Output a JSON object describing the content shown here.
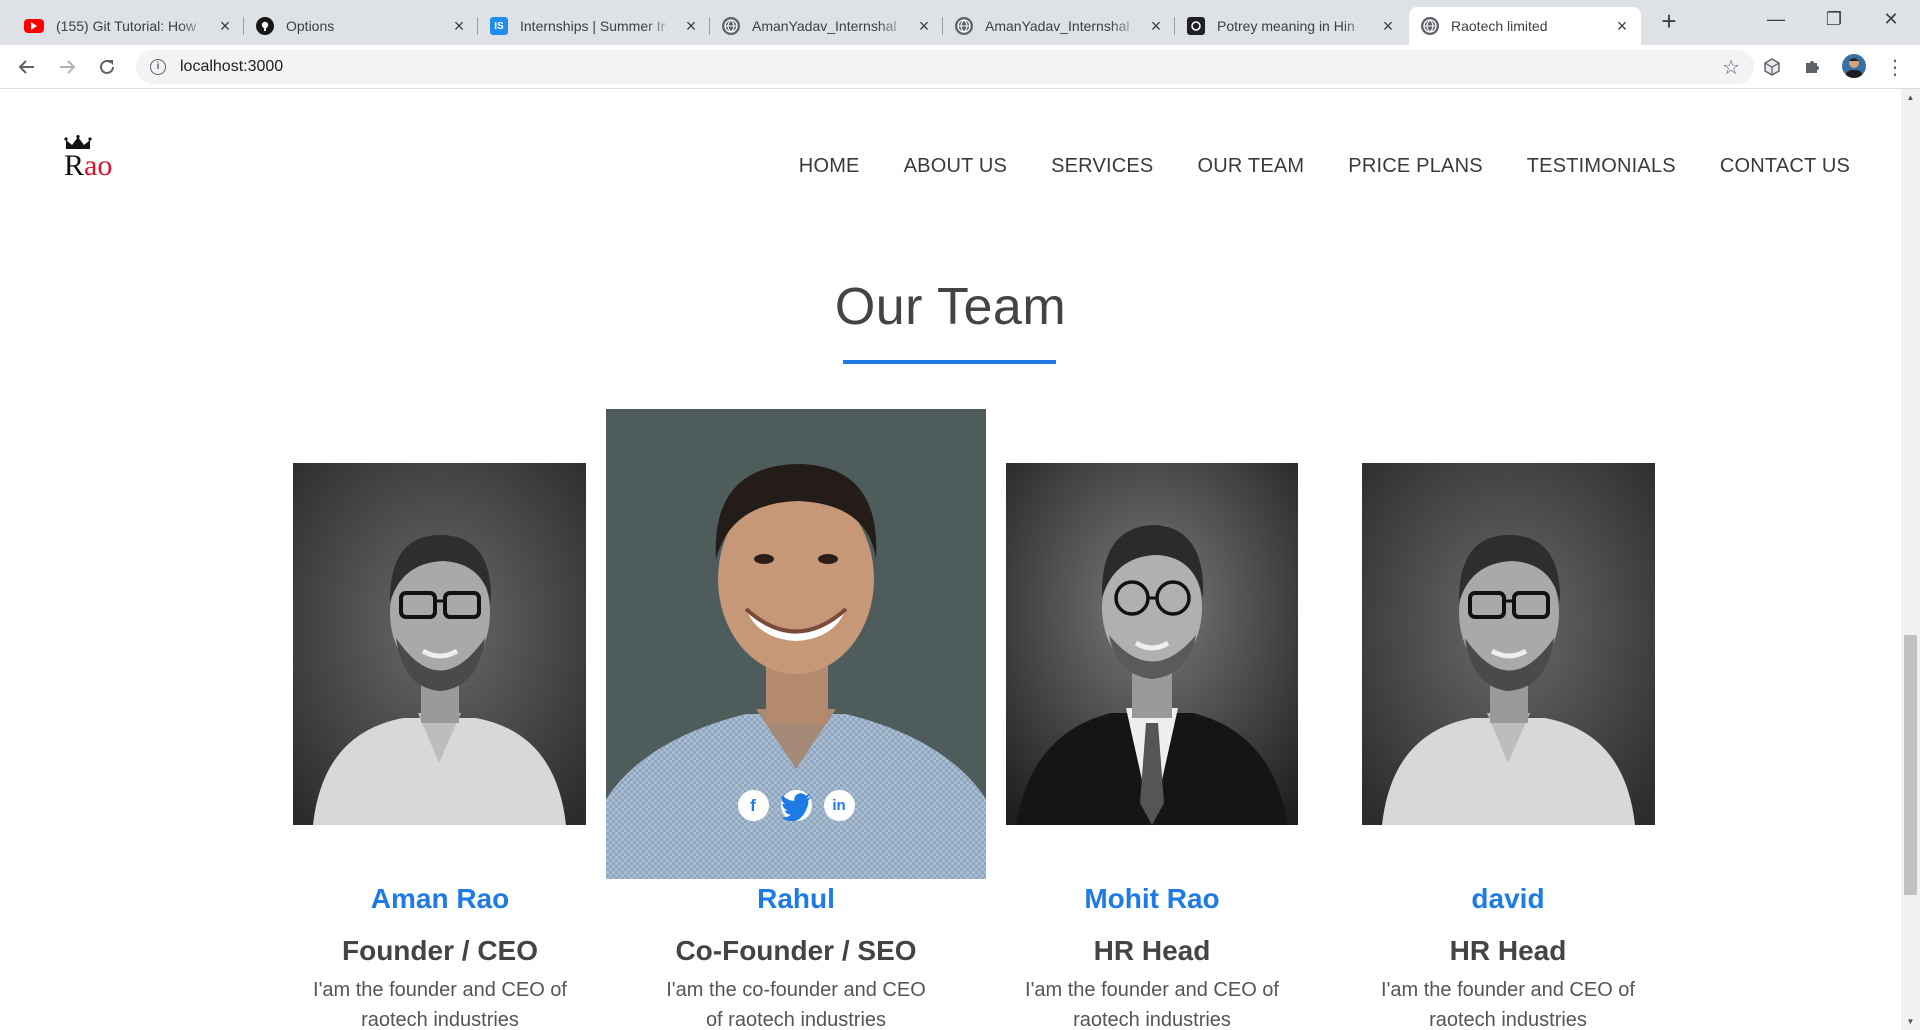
{
  "browser": {
    "tabs": [
      {
        "title": "(155) Git Tutorial: How",
        "icon": "youtube-icon",
        "color": "#ff0000"
      },
      {
        "title": "Options",
        "icon": "github-icon",
        "color": "#181717"
      },
      {
        "title": "Internships | Summer Ir",
        "icon": "internshala-icon",
        "color": "#1f8ded"
      },
      {
        "title": "AmanYadav_Internshal",
        "icon": "globe-icon",
        "color": "#5f6368"
      },
      {
        "title": "AmanYadav_Internshal",
        "icon": "globe-icon",
        "color": "#5f6368"
      },
      {
        "title": "Potrey meaning in Hin",
        "icon": "dictionary-icon",
        "color": "#202124"
      },
      {
        "title": "Raotech limited",
        "icon": "globe-icon",
        "color": "#5f6368"
      }
    ],
    "url": "localhost:3000"
  },
  "site": {
    "logo": {
      "r": "R",
      "ao": "ao"
    },
    "nav": [
      "HOME",
      "ABOUT US",
      "SERVICES",
      "OUR TEAM",
      "PRICE PLANS",
      "TESTIMONIALS",
      "CONTACT US"
    ]
  },
  "team": {
    "title": "Our Team",
    "accent": "#1e7be6",
    "members": [
      {
        "name": "Aman Rao",
        "role": "Founder / CEO",
        "desc_line1": "I'am the founder and CEO of",
        "desc_line2": "raotech industries"
      },
      {
        "name": "Rahul",
        "role": "Co-Founder / SEO",
        "desc_line1": "I'am the co-founder and CEO",
        "desc_line2": "of raotech industries"
      },
      {
        "name": "Mohit Rao",
        "role": "HR Head",
        "desc_line1": "I'am the founder and CEO of",
        "desc_line2": "raotech industries"
      },
      {
        "name": "david",
        "role": "HR Head",
        "desc_line1": "I'am the founder and CEO of",
        "desc_line2": "raotech industries"
      }
    ],
    "social": [
      "f",
      "t",
      "in"
    ]
  }
}
